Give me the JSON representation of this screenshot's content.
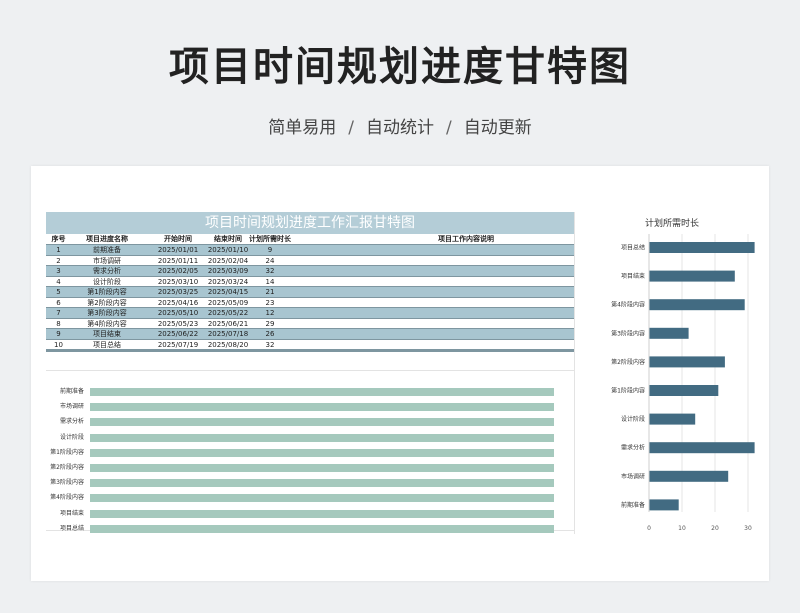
{
  "page": {
    "title": "项目时间规划进度甘特图",
    "features": [
      "简单易用",
      "自动统计",
      "自动更新"
    ],
    "separator": "/"
  },
  "table": {
    "title": "项目时间规划进度工作汇报甘特图",
    "headers": [
      "序号",
      "项目进度名称",
      "开始时间",
      "结束时间",
      "计划所需时长",
      "项目工作内容说明"
    ],
    "rows": [
      [
        "1",
        "前期准备",
        "2025/01/01",
        "2025/01/10",
        "9",
        ""
      ],
      [
        "2",
        "市场调研",
        "2025/01/11",
        "2025/02/04",
        "24",
        ""
      ],
      [
        "3",
        "需求分析",
        "2025/02/05",
        "2025/03/09",
        "32",
        ""
      ],
      [
        "4",
        "设计阶段",
        "2025/03/10",
        "2025/03/24",
        "14",
        ""
      ],
      [
        "5",
        "第1阶段内容",
        "2025/03/25",
        "2025/04/15",
        "21",
        ""
      ],
      [
        "6",
        "第2阶段内容",
        "2025/04/16",
        "2025/05/09",
        "23",
        ""
      ],
      [
        "7",
        "第3阶段内容",
        "2025/05/10",
        "2025/05/22",
        "12",
        ""
      ],
      [
        "8",
        "第4阶段内容",
        "2025/05/23",
        "2025/06/21",
        "29",
        ""
      ],
      [
        "9",
        "项目结束",
        "2025/06/22",
        "2025/07/18",
        "26",
        ""
      ],
      [
        "10",
        "项目总结",
        "2025/07/19",
        "2025/08/20",
        "32",
        ""
      ]
    ]
  },
  "gantt": {
    "labels": [
      "前期准备",
      "市场调研",
      "需求分析",
      "设计阶段",
      "第1阶段内容",
      "第2阶段内容",
      "第3阶段内容",
      "第4阶段内容",
      "项目结束",
      "项目总结"
    ]
  },
  "chart_data": {
    "type": "bar",
    "orientation": "horizontal",
    "title": "计划所需时长",
    "categories": [
      "项目总结",
      "项目结束",
      "第4阶段内容",
      "第3阶段内容",
      "第2阶段内容",
      "第1阶段内容",
      "设计阶段",
      "需求分析",
      "市场调研",
      "前期准备"
    ],
    "values": [
      32,
      26,
      29,
      12,
      23,
      21,
      14,
      32,
      24,
      9
    ],
    "xticks": [
      0,
      10,
      20,
      30,
      40
    ],
    "xlim": [
      0,
      40
    ],
    "grid": true,
    "bar_color": "#426b82"
  }
}
